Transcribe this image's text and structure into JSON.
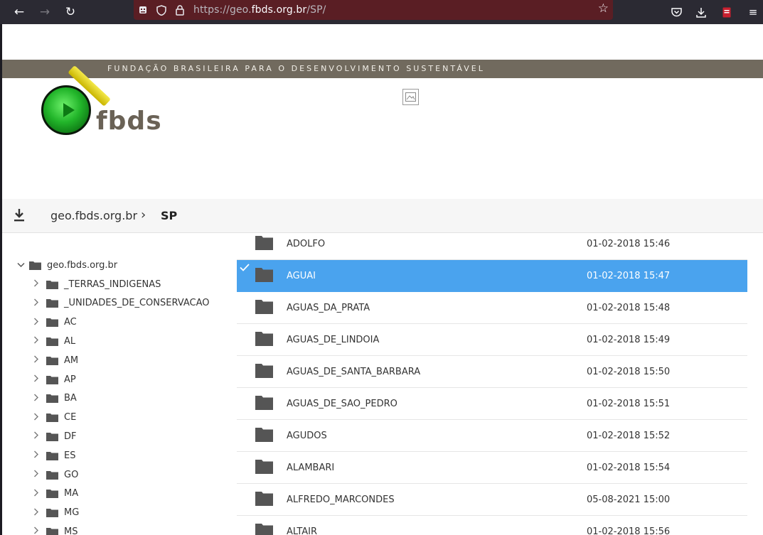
{
  "browser": {
    "url_prefix": "https://geo.",
    "url_host": "fbds.org.br",
    "url_path": "/SP/"
  },
  "header": {
    "banner_text": "FUNDAÇÃO BRASILEIRA PARA O DESENVOLVIMENTO SUSTENTÁVEL",
    "logo_text": "fbds"
  },
  "breadcrumb": {
    "root": "geo.fbds.org.br",
    "separator": "›",
    "current": "SP"
  },
  "tree": {
    "root": "geo.fbds.org.br",
    "items": [
      "_TERRAS_INDIGENAS",
      "_UNIDADES_DE_CONSERVACAO",
      "AC",
      "AL",
      "AM",
      "AP",
      "BA",
      "CE",
      "DF",
      "ES",
      "GO",
      "MA",
      "MG",
      "MS"
    ]
  },
  "files": [
    {
      "name": "ADOLFO",
      "date": "01-02-2018 15:46"
    },
    {
      "name": "AGUAI",
      "date": "01-02-2018 15:47",
      "selected": true
    },
    {
      "name": "AGUAS_DA_PRATA",
      "date": "01-02-2018 15:48"
    },
    {
      "name": "AGUAS_DE_LINDOIA",
      "date": "01-02-2018 15:49"
    },
    {
      "name": "AGUAS_DE_SANTA_BARBARA",
      "date": "01-02-2018 15:50"
    },
    {
      "name": "AGUAS_DE_SAO_PEDRO",
      "date": "01-02-2018 15:51"
    },
    {
      "name": "AGUDOS",
      "date": "01-02-2018 15:52"
    },
    {
      "name": "ALAMBARI",
      "date": "01-02-2018 15:54"
    },
    {
      "name": "ALFREDO_MARCONDES",
      "date": "05-08-2021 15:00"
    },
    {
      "name": "ALTAIR",
      "date": "01-02-2018 15:56"
    }
  ],
  "colors": {
    "selection": "#4aa3ee",
    "banner": "#716a5e",
    "folder": "#555555"
  }
}
